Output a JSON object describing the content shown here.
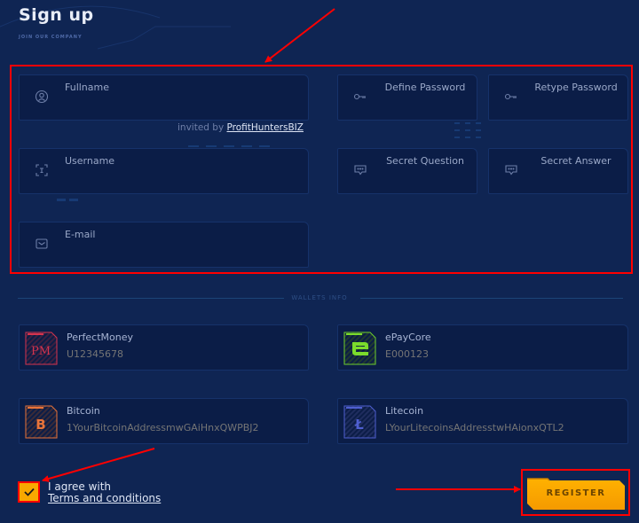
{
  "header": {
    "title": "Sign up",
    "subtitle": "JOIN OUR COMPANY"
  },
  "form": {
    "fullname": {
      "label": "Fullname",
      "icon": "user-circle-icon",
      "value": ""
    },
    "invited_prefix": "invited by",
    "invited_by": "ProfitHuntersBIZ",
    "define_password": {
      "label": "Define Password",
      "icon": "key-icon",
      "value": ""
    },
    "retype_password": {
      "label": "Retype Password",
      "icon": "key-icon",
      "value": ""
    },
    "username": {
      "label": "Username",
      "icon": "face-scan-icon",
      "value": ""
    },
    "secret_question": {
      "label": "Secret Question",
      "icon": "chat-bubble-icon",
      "value": ""
    },
    "secret_answer": {
      "label": "Secret Answer",
      "icon": "chat-bubble-icon",
      "value": ""
    },
    "email": {
      "label": "E-mail",
      "icon": "envelope-icon",
      "value": ""
    }
  },
  "wallets": {
    "section_label": "WALLETS INFO",
    "items": [
      {
        "name": "PerfectMoney",
        "placeholder": "U12345678",
        "logo_text": "PM",
        "color": "#d6344f"
      },
      {
        "name": "ePayCore",
        "placeholder": "E000123",
        "logo_text": "e",
        "color": "#7bdc2c"
      },
      {
        "name": "Bitcoin",
        "placeholder": "1YourBitcoinAddressmwGAiHnxQWPBJ2",
        "logo_text": "B",
        "color": "#e8743a"
      },
      {
        "name": "Litecoin",
        "placeholder": "LYourLitecoinsAddresstwHAionxQTL2",
        "logo_text": "Ł",
        "color": "#4f5fd1"
      }
    ]
  },
  "agreement": {
    "checked": true,
    "text": "I agree with",
    "link": "Terms and conditions"
  },
  "register_label": "REGISTER",
  "colors": {
    "background": "#0f2553",
    "field_bg": "#0b1d47",
    "accent": "#f8a800",
    "annotation": "#ff0000"
  }
}
